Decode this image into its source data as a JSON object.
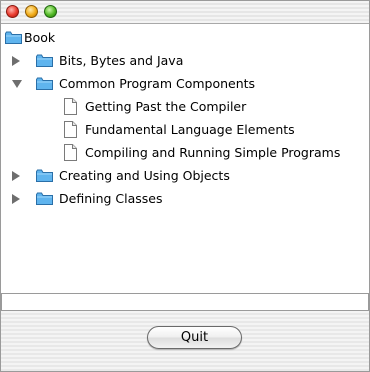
{
  "tree": {
    "root_label": "Book",
    "items": [
      {
        "label": "Bits, Bytes and Java",
        "type": "folder",
        "expanded": false
      },
      {
        "label": "Common Program Components",
        "type": "folder",
        "expanded": true,
        "children": [
          {
            "label": "Getting Past the Compiler",
            "type": "document"
          },
          {
            "label": "Fundamental Language Elements",
            "type": "document"
          },
          {
            "label": "Compiling and Running Simple Programs",
            "type": "document"
          }
        ]
      },
      {
        "label": "Creating and Using Objects",
        "type": "folder",
        "expanded": false
      },
      {
        "label": "Defining Classes",
        "type": "folder",
        "expanded": false
      }
    ]
  },
  "status": {
    "text": ""
  },
  "buttons": {
    "quit_label": "Quit"
  },
  "colors": {
    "folder_blue": "#5fb4ee",
    "close_light": "#ea3b2e",
    "minimize_light": "#f1ab17",
    "zoom_light": "#51b825"
  },
  "icons": {
    "folder": "folder-icon",
    "document": "document-icon",
    "disclosure_collapsed": "disclosure-triangle-right-icon",
    "disclosure_expanded": "disclosure-triangle-down-icon"
  }
}
